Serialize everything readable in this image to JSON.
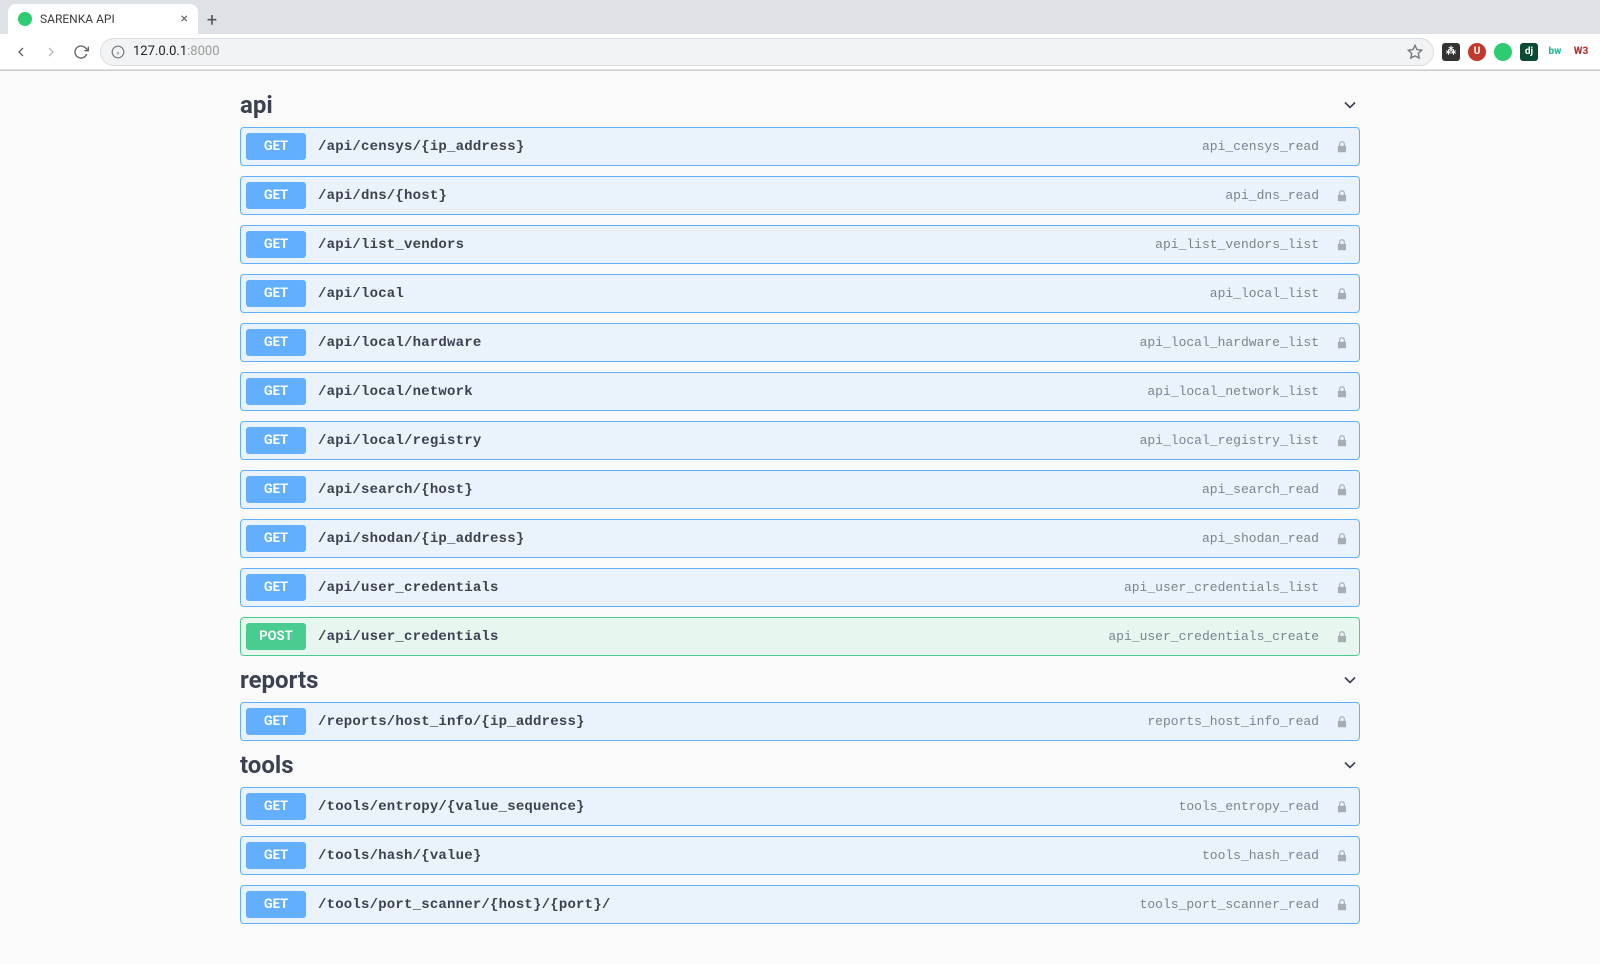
{
  "browser": {
    "tab_title": "SARENKA API",
    "url_host": "127.0.0.1",
    "url_port": ":8000"
  },
  "sections": [
    {
      "name": "api",
      "ops": [
        {
          "method": "GET",
          "path": "/api/censys/{ip_address}",
          "opid": "api_censys_read"
        },
        {
          "method": "GET",
          "path": "/api/dns/{host}",
          "opid": "api_dns_read"
        },
        {
          "method": "GET",
          "path": "/api/list_vendors",
          "opid": "api_list_vendors_list"
        },
        {
          "method": "GET",
          "path": "/api/local",
          "opid": "api_local_list"
        },
        {
          "method": "GET",
          "path": "/api/local/hardware",
          "opid": "api_local_hardware_list"
        },
        {
          "method": "GET",
          "path": "/api/local/network",
          "opid": "api_local_network_list"
        },
        {
          "method": "GET",
          "path": "/api/local/registry",
          "opid": "api_local_registry_list"
        },
        {
          "method": "GET",
          "path": "/api/search/{host}",
          "opid": "api_search_read"
        },
        {
          "method": "GET",
          "path": "/api/shodan/{ip_address}",
          "opid": "api_shodan_read"
        },
        {
          "method": "GET",
          "path": "/api/user_credentials",
          "opid": "api_user_credentials_list"
        },
        {
          "method": "POST",
          "path": "/api/user_credentials",
          "opid": "api_user_credentials_create"
        }
      ]
    },
    {
      "name": "reports",
      "ops": [
        {
          "method": "GET",
          "path": "/reports/host_info/{ip_address}",
          "opid": "reports_host_info_read"
        }
      ]
    },
    {
      "name": "tools",
      "ops": [
        {
          "method": "GET",
          "path": "/tools/entropy/{value_sequence}",
          "opid": "tools_entropy_read"
        },
        {
          "method": "GET",
          "path": "/tools/hash/{value}",
          "opid": "tools_hash_read"
        },
        {
          "method": "GET",
          "path": "/tools/port_scanner/{host}/{port}/",
          "opid": "tools_port_scanner_read"
        }
      ]
    }
  ]
}
